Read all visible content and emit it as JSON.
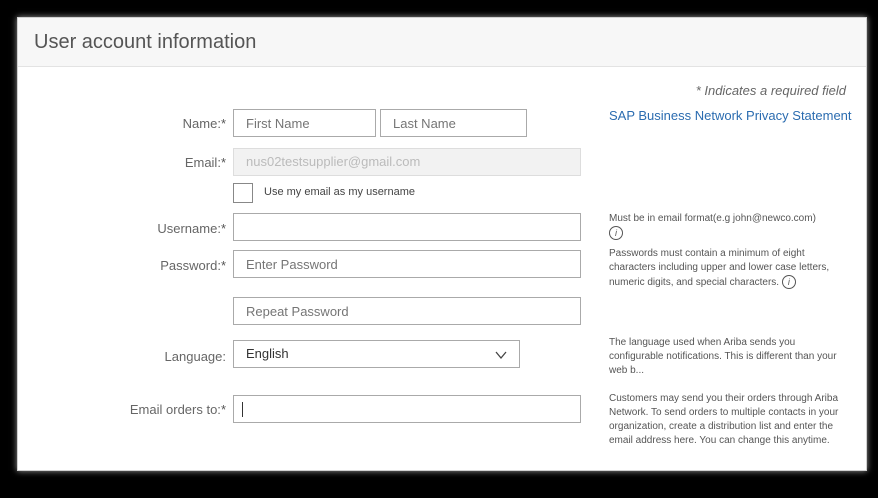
{
  "header": {
    "title": "User account information"
  },
  "required_note": "* Indicates a required field",
  "privacy_link": "SAP Business Network Privacy Statement",
  "fields": {
    "name": {
      "label": "Name:",
      "required_mark": "*",
      "first_placeholder": "First Name",
      "last_placeholder": "Last Name"
    },
    "email": {
      "label": "Email:",
      "required_mark": "*",
      "value": "nus02testsupplier@gmail.com"
    },
    "use_email_checkbox": {
      "label": "Use my email as my username"
    },
    "username": {
      "label": "Username:",
      "required_mark": "*",
      "value": "",
      "help": "Must be in email format(e.g john@newco.com)"
    },
    "password": {
      "label": "Password:",
      "required_mark": "*",
      "placeholder": "Enter Password",
      "repeat_placeholder": "Repeat Password",
      "help": "Passwords must contain a minimum of eight characters including upper and lower case letters, numeric digits, and special characters."
    },
    "language": {
      "label": "Language:",
      "value": "English",
      "help": "The language used when Ariba sends you configurable notifications. This is different than your web b..."
    },
    "email_orders": {
      "label": "Email orders to:",
      "required_mark": "*",
      "value": "",
      "help": "Customers may send you their orders through Ariba Network. To send orders to multiple contacts in your organization, create a distribution list and enter the email address here. You can change this anytime."
    }
  },
  "icons": {
    "info": "info-icon",
    "chevron": "chevron-down-icon"
  }
}
